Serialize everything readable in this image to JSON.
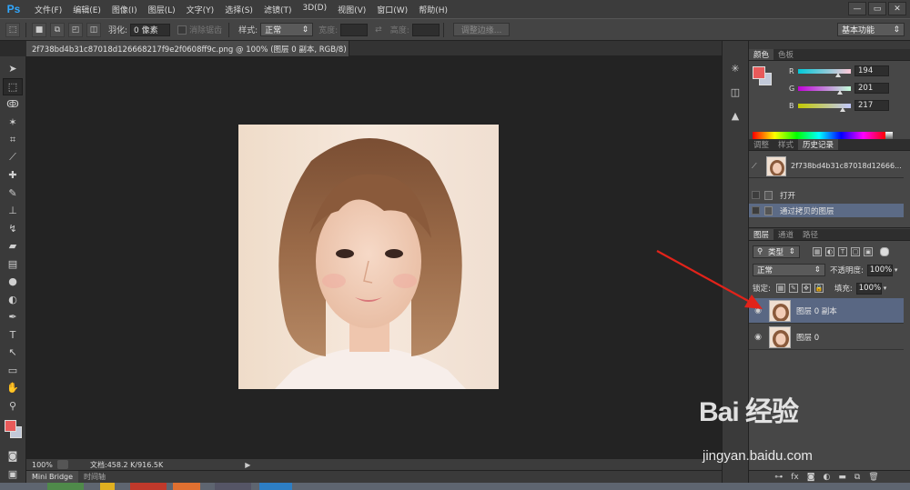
{
  "app": {
    "logo": "Ps",
    "menus": [
      "文件(F)",
      "编辑(E)",
      "图像(I)",
      "图层(L)",
      "文字(Y)",
      "选择(S)",
      "滤镜(T)",
      "3D(D)",
      "视图(V)",
      "窗口(W)",
      "帮助(H)"
    ],
    "window_controls": [
      "—",
      "▭",
      "✕"
    ]
  },
  "options_bar": {
    "feather_label": "羽化:",
    "feather_value": "0 像素",
    "antialias_label": "消除锯齿",
    "style_label": "样式:",
    "style_value": "正常",
    "width_label": "宽度:",
    "height_label": "高度:",
    "refine_edge_label": "调整边缘...",
    "workspace": "基本功能"
  },
  "document": {
    "tab_title": "2f738bd4b31c87018d126668217f9e2f0608ff9c.png @ 100% (图层 0 副本, RGB/8) *",
    "tab_close": "×",
    "zoom": "100%",
    "doc_size": "文档:458.2 K/916.5K"
  },
  "bottom_tabs": [
    "Mini Bridge",
    "时间轴"
  ],
  "color_panel": {
    "tabs": [
      "颜色",
      "色板"
    ],
    "channels": [
      {
        "label": "R",
        "value": "194",
        "fraction": 0.76
      },
      {
        "label": "G",
        "value": "201",
        "fraction": 0.79
      },
      {
        "label": "B",
        "value": "217",
        "fraction": 0.85
      }
    ],
    "foreground": "#e85a5a",
    "background": "#c2c9d9"
  },
  "history_panel": {
    "tabs": [
      "调整",
      "样式",
      "历史记录"
    ],
    "snapshot_name": "2f738bd4b31c87018d12666...",
    "items": [
      {
        "label": "打开",
        "selected": false
      },
      {
        "label": "通过拷贝的图层",
        "selected": true
      }
    ]
  },
  "layers_panel": {
    "tabs": [
      "图层",
      "通道",
      "路径"
    ],
    "filter_label": "类型",
    "blend_mode": "正常",
    "opacity_label": "不透明度:",
    "opacity_value": "100%",
    "lock_label": "锁定:",
    "fill_label": "填充:",
    "fill_value": "100%",
    "layers": [
      {
        "name": "图层 0 副本",
        "selected": true
      },
      {
        "name": "图层 0",
        "selected": false
      }
    ]
  },
  "watermark": {
    "brand": "Bai 经验",
    "url": "jingyan.baidu.com"
  }
}
